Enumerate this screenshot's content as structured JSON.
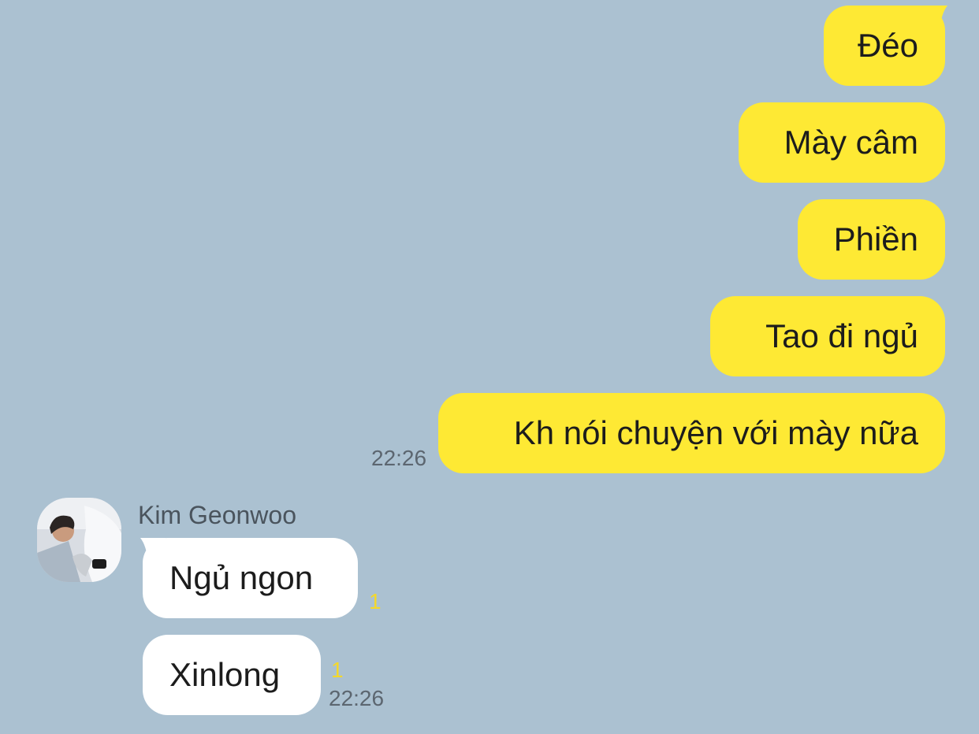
{
  "colors": {
    "background": "#abc1d1",
    "sent_bubble": "#fee934",
    "received_bubble": "#ffffff",
    "unread_count": "#f4d82a",
    "timestamp": "#5c6670"
  },
  "outgoing": [
    {
      "text": "Đéo"
    },
    {
      "text": "Mày câm"
    },
    {
      "text": "Phiền"
    },
    {
      "text": "Tao đi ngủ"
    },
    {
      "text": "Kh nói chuyện với mày nữa",
      "time": "22:26"
    }
  ],
  "incoming": {
    "sender": "Kim Geonwoo",
    "avatar_icon": "profile-photo",
    "messages": [
      {
        "text": "Ngủ ngon",
        "unread": "1"
      },
      {
        "text": "Xinlong",
        "unread": "1",
        "time": "22:26"
      }
    ]
  }
}
